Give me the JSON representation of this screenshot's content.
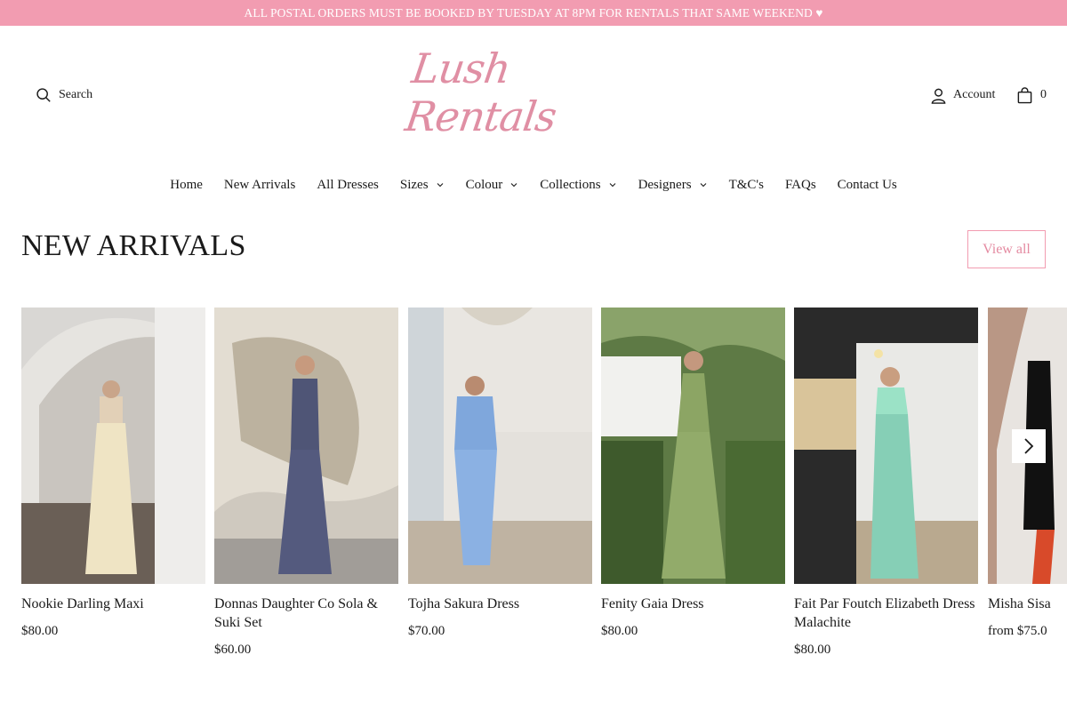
{
  "announcement": "ALL POSTAL ORDERS MUST BE BOOKED BY TUESDAY AT 8PM FOR RENTALS THAT SAME WEEKEND ♥",
  "header": {
    "search_label": "Search",
    "logo_text": "Lush Rentals",
    "account_label": "Account",
    "cart_count": "0"
  },
  "nav": {
    "items": [
      {
        "label": "Home",
        "dropdown": false
      },
      {
        "label": "New Arrivals",
        "dropdown": false
      },
      {
        "label": "All Dresses",
        "dropdown": false
      },
      {
        "label": "Sizes",
        "dropdown": true
      },
      {
        "label": "Colour",
        "dropdown": true
      },
      {
        "label": "Collections",
        "dropdown": true
      },
      {
        "label": "Designers",
        "dropdown": true
      },
      {
        "label": "T&C's",
        "dropdown": false
      },
      {
        "label": "FAQs",
        "dropdown": false
      },
      {
        "label": "Contact Us",
        "dropdown": false
      }
    ]
  },
  "section": {
    "title": "NEW ARRIVALS",
    "view_all_label": "View all"
  },
  "products": [
    {
      "name": "Nookie Darling Maxi",
      "price": "$80.00"
    },
    {
      "name": "Donnas Daughter Co Sola & Suki Set",
      "price": "$60.00"
    },
    {
      "name": "Tojha Sakura Dress",
      "price": "$70.00"
    },
    {
      "name": "Fenity Gaia Dress",
      "price": "$80.00"
    },
    {
      "name": "Fait Par Foutch Elizabeth Dress Malachite",
      "price": "$80.00"
    },
    {
      "name": "Misha Sisa",
      "price": "from $75.0"
    }
  ],
  "colors": {
    "accent": "#f29cb1",
    "logo": "#e08fa4",
    "text": "#1a1a1a"
  },
  "icons": {
    "search": "search-icon",
    "account": "user-icon",
    "cart": "shopping-bag-icon",
    "dropdown": "chevron-down-icon",
    "carousel": "chevron-right-icon"
  }
}
